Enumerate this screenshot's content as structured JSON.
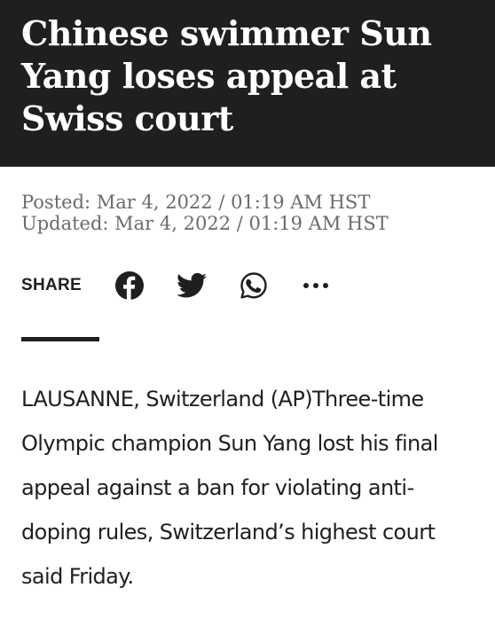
{
  "article": {
    "headline": "Chinese swimmer Sun Yang loses appeal at Swiss court",
    "posted": "Posted: Mar 4, 2022 / 01:19 AM HST",
    "updated": "Updated: Mar 4, 2022 / 01:19 AM HST",
    "body": "LAUSANNE, Switzerland (AP)Three-time Olympic champion Sun Yang lost his final appeal against a ban for violating anti-doping rules, Switzerland’s highest court said Friday."
  },
  "share": {
    "label": "SHARE",
    "icons": [
      "facebook-icon",
      "twitter-icon",
      "whatsapp-icon",
      "more-icon"
    ]
  },
  "colors": {
    "header_bg": "#1f1f1f",
    "headline_text": "#ffffff",
    "meta_text": "#6b6b6b",
    "body_text": "#1f1f1f"
  }
}
